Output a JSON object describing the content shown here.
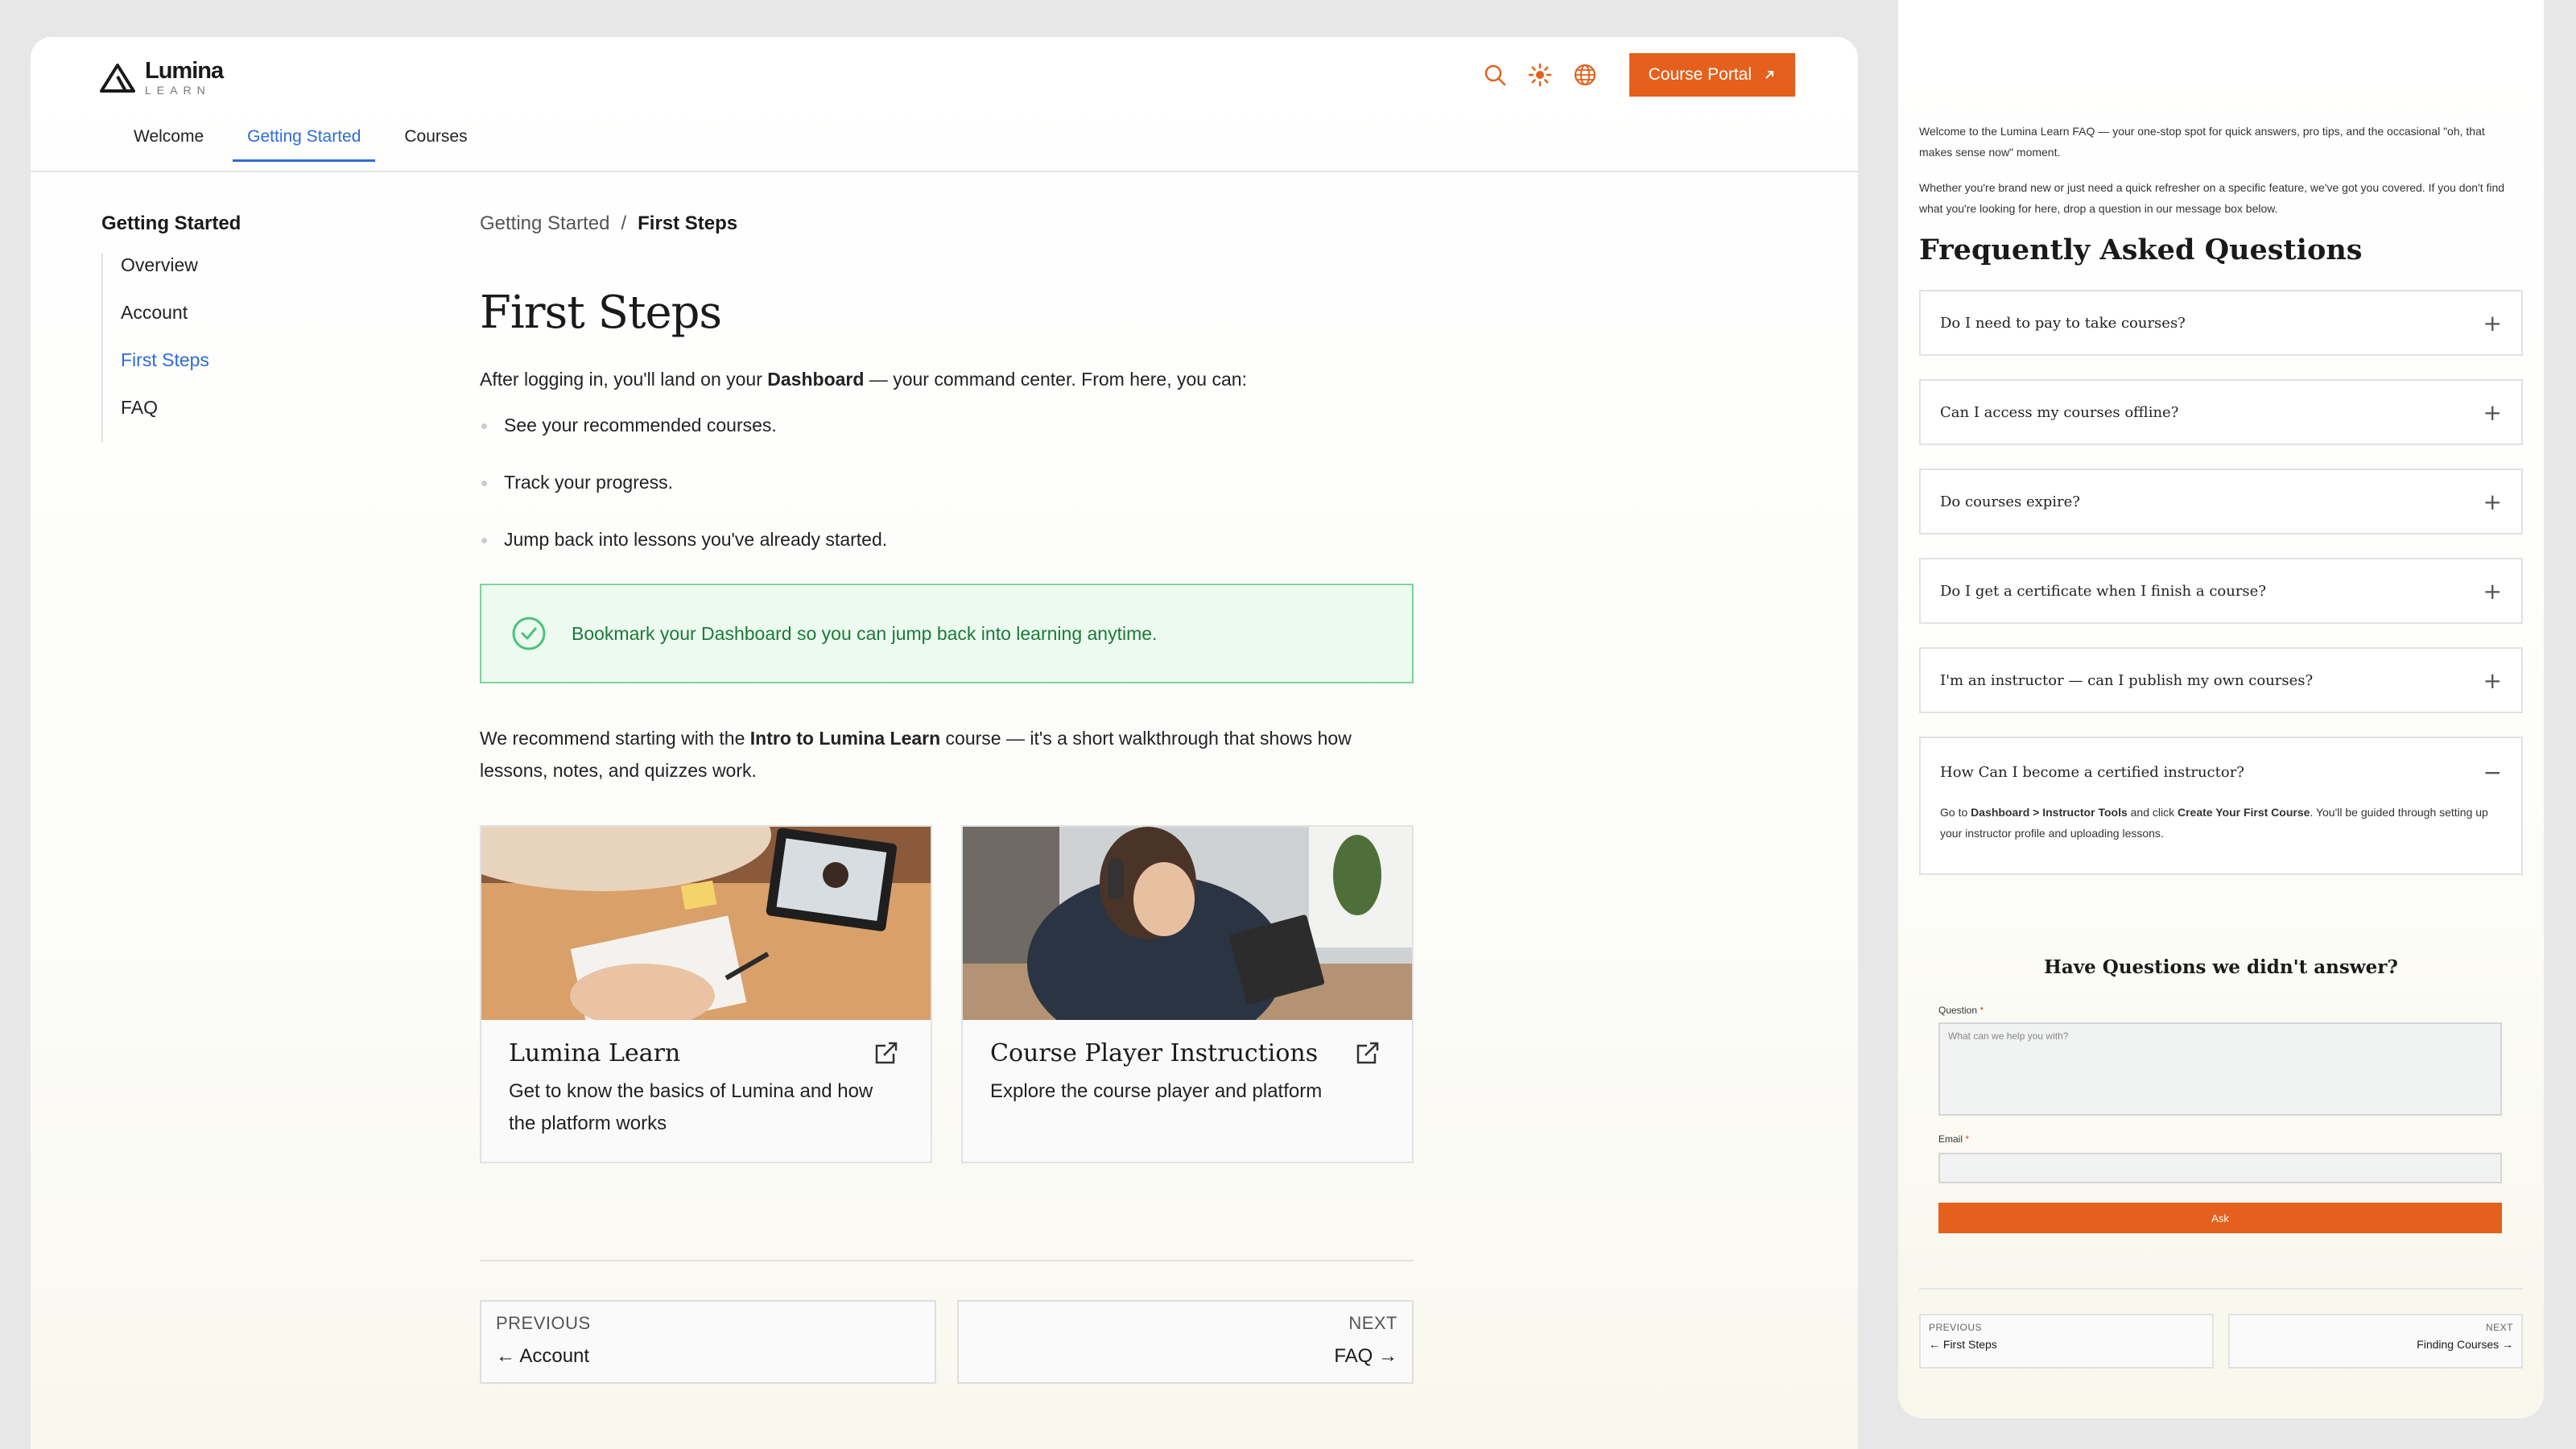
{
  "brand": {
    "name": "Lumina",
    "sub": "LEARN"
  },
  "header": {
    "portal_label": "Course Portal",
    "tabs": [
      "Welcome",
      "Getting Started",
      "Courses"
    ]
  },
  "sidebar": {
    "title": "Getting Started",
    "items": [
      "Overview",
      "Account",
      "First Steps",
      "FAQ"
    ]
  },
  "breadcrumb": {
    "parent": "Getting Started",
    "sep": "/",
    "current": "First Steps"
  },
  "content": {
    "title": "First Steps",
    "intro_pre": "After logging in, you'll land on your ",
    "intro_bold": "Dashboard",
    "intro_post": " — your command center. From here, you can:",
    "bullets": [
      "See your recommended courses.",
      "Track your progress.",
      "Jump back into lessons you've already started."
    ],
    "tip": "Bookmark your Dashboard so you can jump back into learning anytime.",
    "rec_pre": "We recommend starting with the ",
    "rec_bold": "Intro to Lumina Learn",
    "rec_post": " course — it's a short walkthrough that shows how lessons, notes, and quizzes work.",
    "cards": [
      {
        "title": "Lumina Learn",
        "desc": "Get to know the basics of Lumina and how the platform works"
      },
      {
        "title": "Course Player Instructions",
        "desc": "Explore the course player and platform"
      }
    ],
    "pager": {
      "prev_label": "PREVIOUS",
      "prev_link": "Account",
      "next_label": "NEXT",
      "next_link": "FAQ"
    }
  },
  "faq_panel": {
    "intro1": "Welcome to the Lumina Learn FAQ — your one-stop spot for quick answers, pro tips, and the occasional \"oh, that makes sense now\" moment.",
    "intro2": "Whether you're brand new or just need a quick refresher on a specific feature, we've got you covered. If you don't find what you're looking for here, drop a question in our message box below.",
    "title": "Frequently Asked Questions",
    "questions": [
      "Do I need to pay to take courses?",
      "Can I access my courses offline?",
      "Do courses expire?",
      "Do I get a certificate when I finish a course?",
      "I'm an instructor — can I publish my own courses?"
    ],
    "open_question": "How Can I become a certified instructor?",
    "answer_pre": "Go to ",
    "answer_bold1": "Dashboard > Instructor Tools",
    "answer_mid": " and click ",
    "answer_bold2": "Create Your First Course",
    "answer_post": ". You'll be guided through setting up your instructor profile and uploading lessons.",
    "form": {
      "title": "Have Questions we didn't answer?",
      "question_label": "Question",
      "question_placeholder": "What can we help you with?",
      "email_label": "Email",
      "required_mark": "*",
      "ask_label": "Ask"
    },
    "pager": {
      "prev_label": "PREVIOUS",
      "prev_link": "First Steps",
      "next_label": "NEXT",
      "next_link": "Finding Courses"
    }
  },
  "colors": {
    "accent": "#e4601c",
    "link": "#2e6bd6",
    "tip_bg": "#ecfaf0",
    "tip_text": "#1c7a3a"
  },
  "icons": [
    "logo-icon",
    "search-icon",
    "sun-icon",
    "globe-icon",
    "external-link-icon",
    "check-circle-icon",
    "plus-icon",
    "minus-icon",
    "arrow-left-icon",
    "arrow-right-icon"
  ]
}
